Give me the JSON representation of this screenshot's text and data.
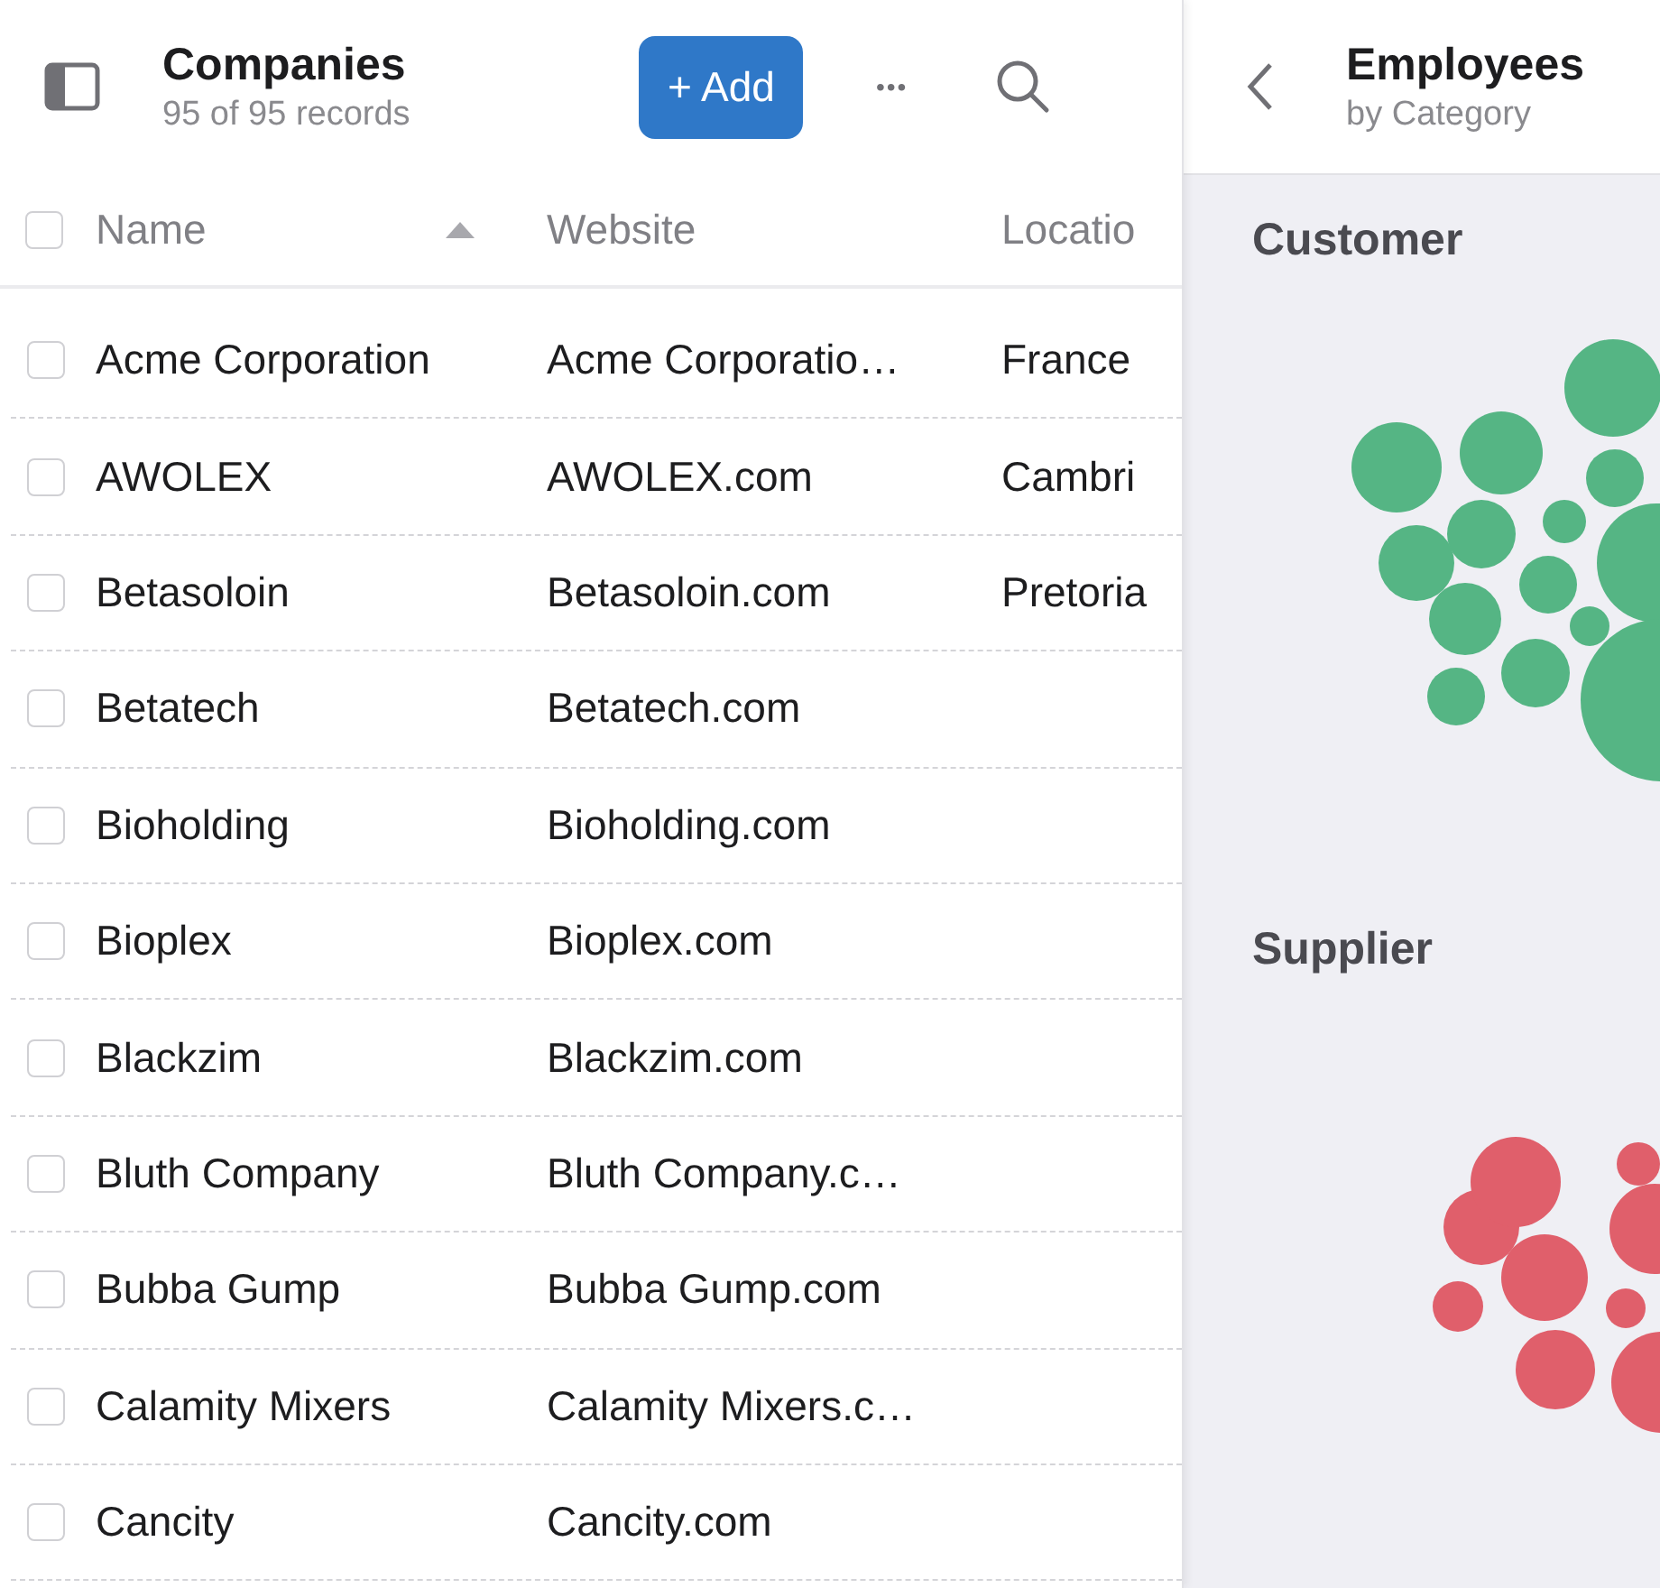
{
  "list_header": {
    "title": "Companies",
    "subtitle": "95 of 95 records",
    "add_button": "+ Add",
    "more_button": "•••"
  },
  "table": {
    "all_checked": false,
    "columns": [
      {
        "label": "Name",
        "sorted": true
      },
      {
        "label": "Website",
        "sorted": false
      },
      {
        "label": "Locatio",
        "sorted": false
      }
    ],
    "rows": [
      {
        "checked": false,
        "cells": [
          "Acme Corporation",
          "Acme Corporatio…",
          "France"
        ]
      },
      {
        "checked": false,
        "cells": [
          "AWOLEX",
          "AWOLEX.com",
          "Cambri"
        ]
      },
      {
        "checked": false,
        "cells": [
          "Betasoloin",
          "Betasoloin.com",
          "Pretoria"
        ]
      },
      {
        "checked": false,
        "cells": [
          "Betatech",
          "Betatech.com",
          ""
        ]
      },
      {
        "checked": false,
        "cells": [
          "Bioholding",
          "Bioholding.com",
          ""
        ]
      },
      {
        "checked": false,
        "cells": [
          "Bioplex",
          "Bioplex.com",
          ""
        ]
      },
      {
        "checked": false,
        "cells": [
          "Blackzim",
          "Blackzim.com",
          ""
        ]
      },
      {
        "checked": false,
        "cells": [
          "Bluth Company",
          "Bluth Company.c…",
          ""
        ]
      },
      {
        "checked": false,
        "cells": [
          "Bubba Gump",
          "Bubba Gump.com",
          ""
        ]
      },
      {
        "checked": false,
        "cells": [
          "Calamity Mixers",
          "Calamity Mixers.c…",
          ""
        ]
      },
      {
        "checked": false,
        "cells": [
          "Cancity",
          "Cancity.com",
          ""
        ]
      }
    ]
  },
  "detail_panel": {
    "title": "Employees",
    "subtitle": "by Category",
    "categories": [
      {
        "label": "Customer",
        "color": "#55b584",
        "kind": "picture"
      },
      {
        "label": "Supplier",
        "color": "#e05f6b",
        "kind": "picture"
      }
    ]
  }
}
